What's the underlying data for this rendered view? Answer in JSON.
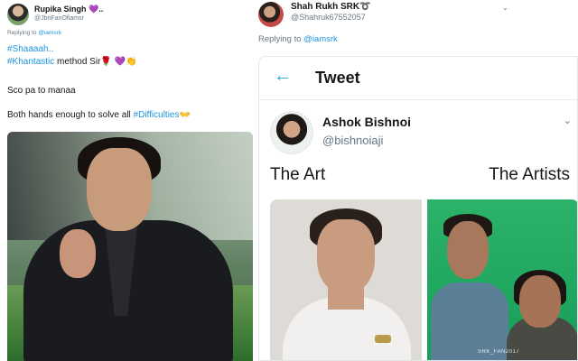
{
  "left_tweet": {
    "display_name": "Rupika Singh 💜..",
    "handle": "@JbriFanOfiamsr",
    "replying_prefix": "Replying to",
    "replying_to": "@iamsrk",
    "line1_hashtag": "#Shaaaah..",
    "line2_hashtag": "#Khantastic",
    "line2_text": " method Sir🌹 💜👏",
    "line3": "Sco pa to manaa",
    "line4_text": "Both hands enough to solve all ",
    "line4_hashtag": "#Difficulties",
    "line4_emoji": "👐"
  },
  "right_tweet": {
    "display_name": "Shah Rukh SRK➰",
    "handle": "@Shahruk67552057",
    "replying_prefix": "Replying to",
    "replying_to": "@iamsrk"
  },
  "embedded_screenshot": {
    "header_title": "Tweet",
    "author_name": "Ashok Bishnoi",
    "author_handle": "@bishnoiaji",
    "caption_left": "The Art",
    "caption_right": "The Artists",
    "watermark": "SRK_FAN2017"
  },
  "icons": {
    "back": "arrow-left-icon",
    "chevron": "chevron-down-icon"
  },
  "colors": {
    "link": "#1b95e0",
    "twitter_blue": "#1da1f2",
    "text": "#14171a",
    "muted": "#657786"
  }
}
